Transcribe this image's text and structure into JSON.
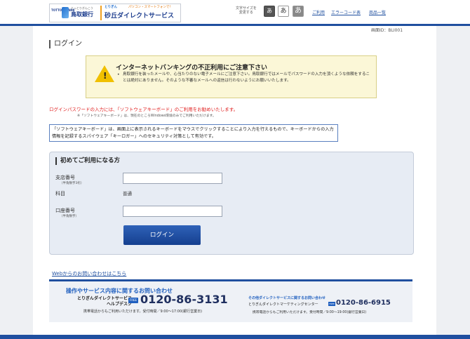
{
  "header": {
    "logo": {
      "tagline": "TOTTORI BANK",
      "bank_sub": "とっとりぎんこう",
      "bank_name": "鳥取銀行",
      "service_small": "とりぎん",
      "service_catch": "パソコン・スマートフォンで！",
      "service_name": "砂丘ダイレクトサービス"
    },
    "font_size_label": "文字サイズを\n変更する",
    "font_size_buttons": [
      "あ",
      "あ",
      "あ"
    ],
    "links": [
      "ご利用",
      "エラーコード表",
      "商品一覧"
    ]
  },
  "screen_id": "画面ID：BLI001",
  "page_title": "ログイン",
  "warning": {
    "title": "インターネットバンキングの不正利用にご注意下さい",
    "bullet": "•",
    "body": "鳥取銀行を装ったメールや、心当たりのない電子メールにご注意下さい。鳥取銀行ではメールでパスワードの入力を頂くような依頼をすることは絶対にありません。そのような不審なメールへの返信は行わないようにお願いいたします。"
  },
  "red_notice": "ログインパスワードの入力には、「ソフトウェアキーボード」のご利用をお勧めいたします。",
  "sub_note": "※「ソフトウェアキーボード」は、現在のところWindows環境のみでご利用いただけます。",
  "info_text": "「ソフトウェアキーボード」は、画面上に表示されるキーボードをマウスでクリックすることにより入力を行えるもので、キーボードからの入力情報を記録するスパイウェア「キーロガー」へのセキュリティ対策として有効です。",
  "login_panel": {
    "title": "初めてご利用になる方",
    "branch_label": "支店番号",
    "branch_hint": "（半角数字3桁）",
    "branch_value": "",
    "subject_label": "科目",
    "subject_value": "普通",
    "account_label": "口座番号",
    "account_hint": "（半角数字）",
    "account_value": "",
    "login_button": "ログイン"
  },
  "web_inquiry_link": "Webからのお問い合わせはこちら",
  "contact": {
    "heading": "操作やサービス内容に関するお問い合わせ",
    "org": "とりぎんダイレクトサービス\nヘルプデスク",
    "free_badge": "FREE",
    "phone": "0120-86-3131",
    "note": "携帯電話からもご利用いただけます。受付時間／9:00～17:00(銀行営業日)",
    "other_heading": "その他ダイレクトサービスに関するお問い合わせ",
    "other_org": "とりぎんダイレクトマーケティングセンター",
    "other_phone": "0120-86-6915",
    "other_note": "携帯電話からもご利用いただけます。受付時間／9:00～19:00(銀行営業日)"
  },
  "colors": {
    "brand_blue": "#1f4f9f",
    "warning_bg": "#fbf7d7",
    "notice_red": "#e02020",
    "panel_bg": "#e7ecf4"
  }
}
